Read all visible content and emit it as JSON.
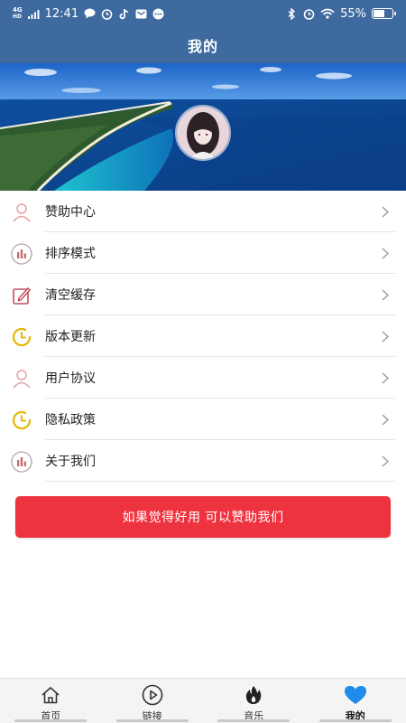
{
  "status_bar": {
    "network": "4G",
    "network_sub": "HD",
    "time": "12:41",
    "battery": "55%",
    "battery_level": 0.55
  },
  "header": {
    "title": "我的"
  },
  "colors": {
    "header_bg": "#3e6aa0",
    "accent_red": "#ee3340",
    "active_tab": "#1e8ce8",
    "icon_pink": "#e8a0a0",
    "icon_gold": "#e6b800"
  },
  "menu": {
    "items": [
      {
        "label": "赞助中心",
        "icon": "person-icon"
      },
      {
        "label": "排序模式",
        "icon": "bar-chart-icon"
      },
      {
        "label": "清空缓存",
        "icon": "edit-icon"
      },
      {
        "label": "版本更新",
        "icon": "clock-icon"
      },
      {
        "label": "用户协议",
        "icon": "person-icon"
      },
      {
        "label": "隐私政策",
        "icon": "clock-icon"
      },
      {
        "label": "关于我们",
        "icon": "bar-chart-icon"
      }
    ]
  },
  "sponsor_button": {
    "label": "如果觉得好用 可以赞助我们"
  },
  "tabbar": {
    "tabs": [
      {
        "label": "首页",
        "icon": "home-icon",
        "active": false
      },
      {
        "label": "链接",
        "icon": "play-icon",
        "active": false
      },
      {
        "label": "音乐",
        "icon": "flame-icon",
        "active": false
      },
      {
        "label": "我的",
        "icon": "heart-icon",
        "active": true
      }
    ]
  }
}
